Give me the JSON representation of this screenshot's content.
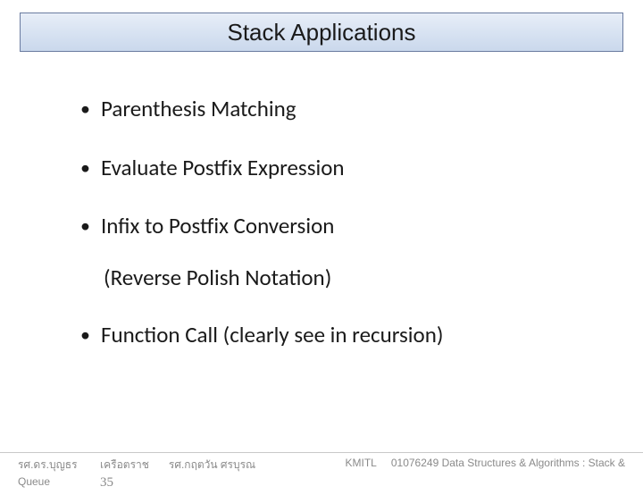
{
  "title": "Stack Applications",
  "bullets": {
    "b1": "Parenthesis Matching",
    "b2": "Evaluate Postfix Expression",
    "b3": "Infix to Postfix Conversion",
    "b3_sub": "(Reverse Polish Notation)",
    "b4": "Function Call (clearly see in recursion)"
  },
  "footer": {
    "author1_a": "รศ.ดร.บุญธร",
    "author1_b": "Queue",
    "author2": "เครือตราช",
    "page_num": "35",
    "author3": "รศ.กฤตวัน   ศรบุรณ",
    "inst": "KMITL",
    "course": "01076249 Data Structures & Algorithms : Stack &"
  }
}
